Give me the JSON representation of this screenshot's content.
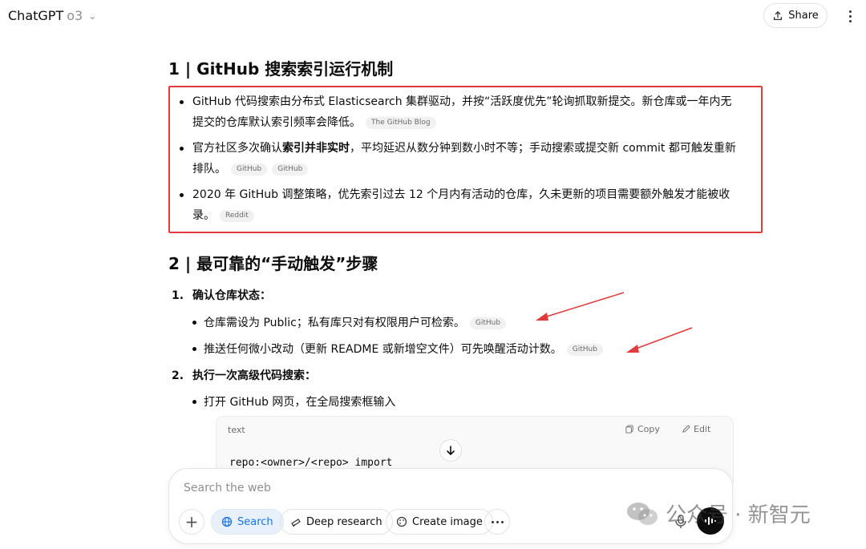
{
  "header": {
    "app_name": "ChatGPT",
    "model": "o3",
    "share_label": "Share"
  },
  "section1": {
    "title": "1 | GitHub 搜索索引运行机制",
    "bullets": [
      {
        "text_a": "GitHub 代码搜索由分布式 Elasticsearch 集群驱动，并按“活跃度优先”轮询抓取新提交。新仓库或一年内无提交的仓库默认索引频率会降低。",
        "tags": [
          "The GitHub Blog"
        ]
      },
      {
        "text_pre": "官方社区多次确认",
        "text_bold": "索引并非实时",
        "text_post": "，平均延迟从数分钟到数小时不等；手动搜索或提交新 commit 都可触发重新排队。",
        "tags": [
          "GitHub",
          "GitHub"
        ]
      },
      {
        "text_a": "2020 年 GitHub 调整策略，优先索引过去 12 个月内有活动的仓库，久未更新的项目需要额外触发才能被收录。",
        "tags": [
          "Reddit"
        ]
      }
    ]
  },
  "section2": {
    "title": "2 | 最可靠的“手动触发”步骤",
    "steps": [
      {
        "num": "1.",
        "label": "确认仓库状态：",
        "subs": [
          {
            "text": "仓库需设为 Public；私有库只对有权限用户可检索。",
            "tag": "GitHub"
          },
          {
            "text": "推送任何微小改动（更新 README 或新增空文件）可先唤醒活动计数。",
            "tag": "GitHub"
          }
        ]
      },
      {
        "num": "2.",
        "label": "执行一次高级代码搜索：",
        "subs": [
          {
            "text": "打开 GitHub 网页，在全局搜索框输入"
          }
        ]
      }
    ],
    "code": {
      "lang": "text",
      "copy_label": "Copy",
      "edit_label": "Edit",
      "content": "repo:<owner>/<repo> import"
    }
  },
  "composer": {
    "placeholder": "Search the web",
    "search_label": "Search",
    "deep_research_label": "Deep research",
    "create_image_label": "Create image"
  },
  "watermark": {
    "text": "公众号 · 新智元"
  },
  "colors": {
    "highlight_box": "#e23b3b",
    "accent": "#1a73e8"
  }
}
